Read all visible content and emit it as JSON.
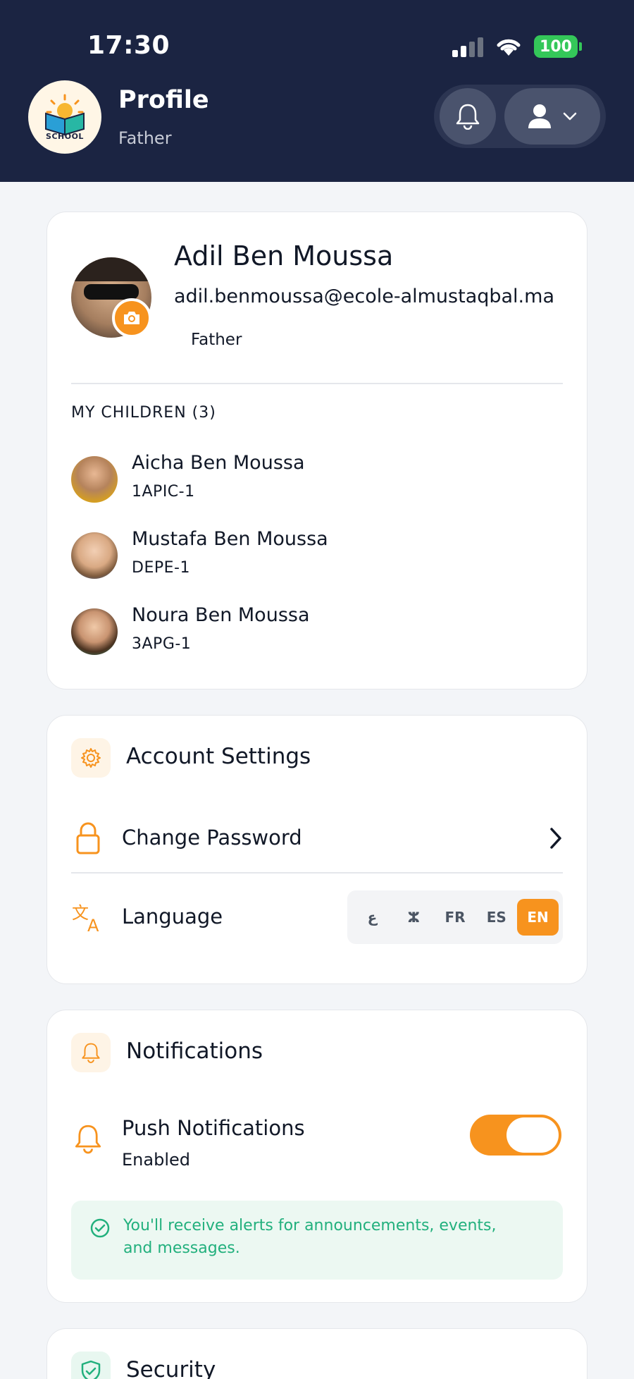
{
  "status_bar": {
    "time": "17:30",
    "battery": "100"
  },
  "header": {
    "logo_text": "SCHOOL",
    "title": "Profile",
    "subtitle": "Father"
  },
  "profile": {
    "name": "Adil Ben Moussa",
    "email": "adil.benmoussa@ecole-almustaqbal.ma",
    "role": "Father",
    "children_title": "MY CHILDREN (3)",
    "children": [
      {
        "name": "Aicha Ben Moussa",
        "class": "1APIC-1"
      },
      {
        "name": "Mustafa Ben Moussa",
        "class": "DEPE-1"
      },
      {
        "name": "Noura Ben Moussa",
        "class": "3APG-1"
      }
    ]
  },
  "account_settings": {
    "title": "Account Settings",
    "change_password": "Change Password",
    "language_label": "Language",
    "languages": [
      "ع",
      "ⵣ",
      "FR",
      "ES",
      "EN"
    ],
    "selected_language": "EN"
  },
  "notifications": {
    "title": "Notifications",
    "push_label": "Push Notifications",
    "push_status": "Enabled",
    "push_enabled": true,
    "info": "You'll receive alerts for announcements, events, and messages."
  },
  "security": {
    "title": "Security"
  },
  "colors": {
    "header_bg": "#1b2442",
    "accent": "#f7931e",
    "success": "#22b07d"
  }
}
